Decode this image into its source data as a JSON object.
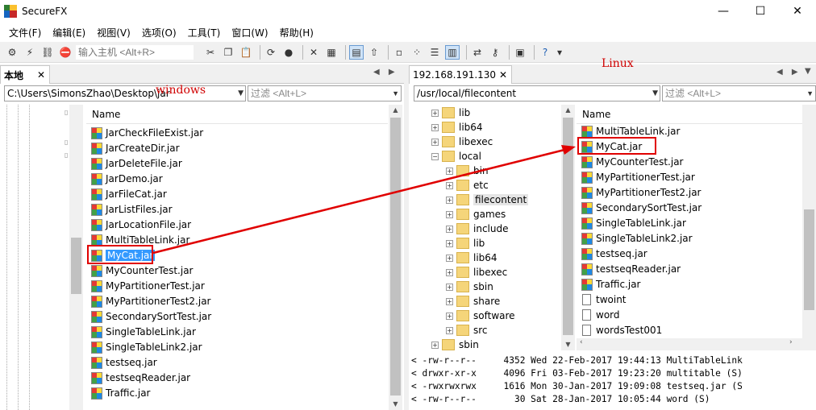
{
  "window": {
    "title": "SecureFX",
    "minimize_glyph": "—",
    "maximize_glyph": "☐",
    "close_glyph": "✕"
  },
  "menu": [
    "文件(F)",
    "编辑(E)",
    "视图(V)",
    "选项(O)",
    "工具(T)",
    "窗口(W)",
    "帮助(H)"
  ],
  "toolbar": {
    "host_placeholder": "输入主机 <Alt+R>",
    "overflow_glyph": "▾"
  },
  "local_pane": {
    "tab_label": "本地",
    "tab_close": "✕",
    "path": "C:\\Users\\SimonsZhao\\Desktop\\jar",
    "filter_placeholder": "过滤 <Alt+L>",
    "annotation": "windows",
    "list_header": "Name",
    "files": [
      "JarCheckFileExist.jar",
      "JarCreateDir.jar",
      "JarDeleteFile.jar",
      "JarDemo.jar",
      "JarFileCat.jar",
      "JarListFiles.jar",
      "JarLocationFile.jar",
      "MultiTableLink.jar",
      "MyCat.jar",
      "MyCounterTest.jar",
      "MyPartitionerTest.jar",
      "MyPartitionerTest2.jar",
      "SecondarySortTest.jar",
      "SingleTableLink.jar",
      "SingleTableLink2.jar",
      "testseq.jar",
      "testseqReader.jar",
      "Traffic.jar"
    ],
    "selected_file": "MyCat.jar"
  },
  "remote_pane": {
    "tab_label": "192.168.191.130",
    "tab_close": "✕",
    "path": "/usr/local/filecontent",
    "filter_placeholder": "过滤 <Alt+L>",
    "annotation": "Linux",
    "tree": [
      {
        "label": "lib",
        "level": 0
      },
      {
        "label": "lib64",
        "level": 0
      },
      {
        "label": "libexec",
        "level": 0
      },
      {
        "label": "local",
        "level": 0,
        "expanded": true
      },
      {
        "label": "bin",
        "level": 1
      },
      {
        "label": "etc",
        "level": 1
      },
      {
        "label": "filecontent",
        "level": 1,
        "selected": true
      },
      {
        "label": "games",
        "level": 1
      },
      {
        "label": "include",
        "level": 1
      },
      {
        "label": "lib",
        "level": 1
      },
      {
        "label": "lib64",
        "level": 1
      },
      {
        "label": "libexec",
        "level": 1
      },
      {
        "label": "sbin",
        "level": 1
      },
      {
        "label": "share",
        "level": 1
      },
      {
        "label": "software",
        "level": 1
      },
      {
        "label": "src",
        "level": 1
      },
      {
        "label": "sbin",
        "level": 0
      }
    ],
    "list_header": "Name",
    "files": [
      {
        "name": "MultiTableLink.jar",
        "icon": "jar-icon"
      },
      {
        "name": "MyCat.jar",
        "icon": "jar-icon"
      },
      {
        "name": "MyCounterTest.jar",
        "icon": "jar-icon"
      },
      {
        "name": "MyPartitionerTest.jar",
        "icon": "jar-icon"
      },
      {
        "name": "MyPartitionerTest2.jar",
        "icon": "jar-icon"
      },
      {
        "name": "SecondarySortTest.jar",
        "icon": "jar-icon"
      },
      {
        "name": "SingleTableLink.jar",
        "icon": "jar-icon"
      },
      {
        "name": "SingleTableLink2.jar",
        "icon": "jar-icon"
      },
      {
        "name": "testseq.jar",
        "icon": "jar-icon"
      },
      {
        "name": "testseqReader.jar",
        "icon": "jar-icon"
      },
      {
        "name": "Traffic.jar",
        "icon": "jar-icon"
      },
      {
        "name": "twoint",
        "icon": "file-icon"
      },
      {
        "name": "word",
        "icon": "file-icon"
      },
      {
        "name": "wordsTest001",
        "icon": "file-icon"
      }
    ],
    "highlighted_file": "MyCat.jar"
  },
  "log": [
    "< -rw-r--r--     4352 Wed 22-Feb-2017 19:44:13 MultiTableLink",
    "< drwxr-xr-x     4096 Fri 03-Feb-2017 19:23:20 multitable (S)",
    "< -rwxrwxrwx     1616 Mon 30-Jan-2017 19:09:08 testseq.jar (S",
    "< -rw-r--r--       30 Sat 28-Jan-2017 10:05:44 word (S)"
  ],
  "colors": {
    "annotation_red": "#e00000",
    "selection_blue": "#3399ff",
    "folder_yellow": "#f5d57a"
  }
}
